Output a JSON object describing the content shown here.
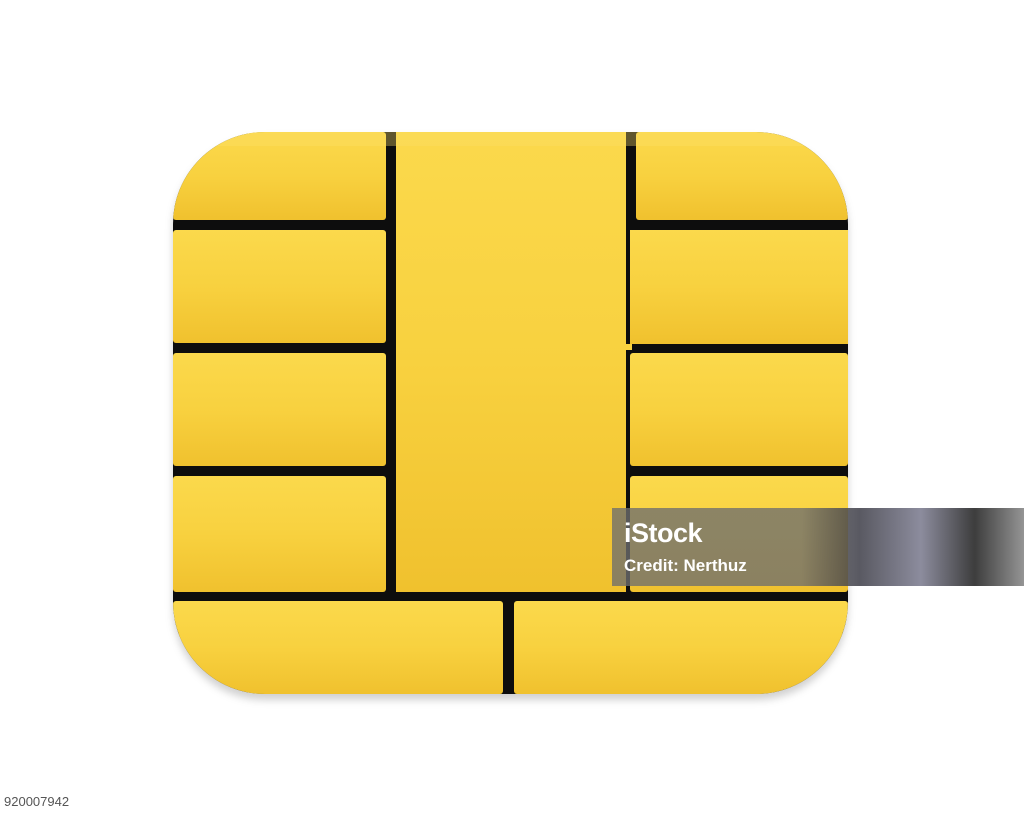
{
  "image": {
    "subject": "EMV smart card chip",
    "background_color": "#ffffff",
    "chip": {
      "contact_color": "#f8cf3a",
      "contact_highlight": "#fbdc52",
      "groove_color": "#111111",
      "contacts": [
        "top-left-contact",
        "left-contact-2",
        "left-contact-3",
        "left-contact-4",
        "center-contact",
        "top-right-contact",
        "right-wide-contact",
        "right-contact-3",
        "right-contact-4",
        "bottom-left-contact",
        "bottom-right-contact"
      ]
    }
  },
  "watermark": {
    "brand": "iStock",
    "credit": "Credit: Nerthuz"
  },
  "stock_id": "920007942"
}
